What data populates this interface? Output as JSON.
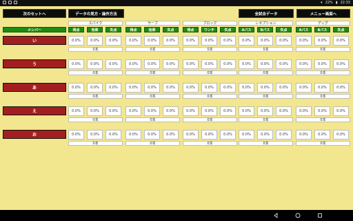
{
  "status_bar": {
    "battery": "22%",
    "time": "22:33"
  },
  "buttons": {
    "next_set": "次のセットへ",
    "how_to": "データの見方・操作方法",
    "all_games": "全試合データ",
    "menu": "メニュー画面へ"
  },
  "member_header": "メンバー",
  "groups": [
    {
      "name": "スパイク",
      "cols": [
        "得点",
        "効果",
        "失点"
      ]
    },
    {
      "name": "サーブ",
      "cols": [
        "得点",
        "効果",
        "失点"
      ]
    },
    {
      "name": "ブロック",
      "cols": [
        "得点",
        "ワンチ",
        "失点"
      ]
    },
    {
      "name": "レセプション",
      "cols": [
        "Aパス",
        "Bパス",
        "失点"
      ]
    },
    {
      "name": "ディグ",
      "cols": [
        "Aパス",
        "Bパス",
        "失点"
      ]
    }
  ],
  "rows": [
    {
      "member": "い",
      "cells": [
        "0.0%",
        "0.0%",
        "0.0%",
        "0.0%",
        "0.0%",
        "0.0%",
        "0.0%",
        "0.0%",
        "0.0%",
        "0.0%",
        "0.0%",
        "0.0%",
        "0.0%",
        "0.0%",
        "0.0%"
      ],
      "totals": [
        "0本",
        "0本",
        "0本",
        "0本",
        "0本"
      ]
    },
    {
      "member": "う",
      "cells": [
        "0.0%",
        "0.0%",
        "0.0%",
        "0.0%",
        "0.0%",
        "0.0%",
        "0.0%",
        "0.0%",
        "0.0%",
        "0.0%",
        "0.0%",
        "0.0%",
        "0.0%",
        "0.0%",
        "0.0%"
      ],
      "totals": [
        "0本",
        "0本",
        "0本",
        "0本",
        "0本"
      ]
    },
    {
      "member": "あ",
      "cells": [
        "0.0%",
        "0.0%",
        "0.0%",
        "0.0%",
        "0.0%",
        "0.0%",
        "0.0%",
        "0.0%",
        "0.0%",
        "0.0%",
        "0.0%",
        "0.0%",
        "0.0%",
        "0.0%",
        "0.0%"
      ],
      "totals": [
        "0本",
        "0本",
        "0本",
        "0本",
        "0本"
      ]
    },
    {
      "member": "え",
      "cells": [
        "0.0%",
        "0.0%",
        "0.0%",
        "0.0%",
        "0.0%",
        "0.0%",
        "0.0%",
        "0.0%",
        "0.0%",
        "0.0%",
        "0.0%",
        "0.0%",
        "0.0%",
        "0.0%",
        "0.0%"
      ],
      "totals": [
        "0本",
        "0本",
        "0本",
        "0本",
        "0本"
      ]
    },
    {
      "member": "お",
      "cells": [
        "0.0%",
        "0.0%",
        "0.0%",
        "0.0%",
        "0.0%",
        "0.0%",
        "0.0%",
        "0.0%",
        "0.0%",
        "0.0%",
        "0.0%",
        "0.0%",
        "0.0%",
        "0.0%",
        "0.0%"
      ],
      "totals": [
        "0本",
        "0本",
        "0本",
        "0本",
        "0本"
      ]
    }
  ],
  "colors": {
    "background": "#f2e68f",
    "member_button": "#a31f1f",
    "header_green": "#1f8a15",
    "top_button": "#0c0c0c"
  },
  "icons": [
    "back-icon",
    "home-icon",
    "recents-icon",
    "battery-icon",
    "wifi-icon"
  ]
}
